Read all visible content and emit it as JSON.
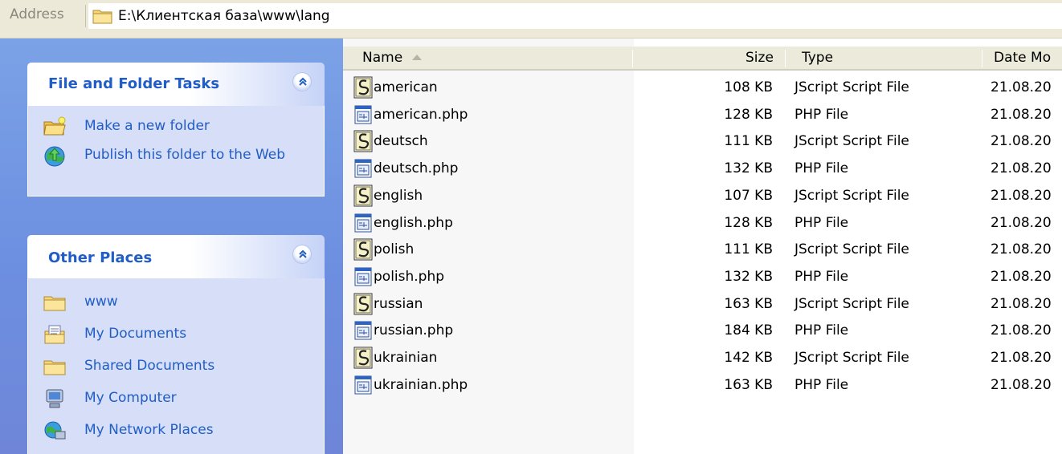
{
  "address": {
    "label": "Address",
    "path": "E:\\Клиентская база\\www\\lang"
  },
  "tasks_panel": {
    "title": "File and Folder Tasks",
    "items": [
      {
        "label": "Make a new folder",
        "icon": "new-folder-icon"
      },
      {
        "label": "Publish this folder to the Web",
        "icon": "globe-publish-icon"
      }
    ]
  },
  "places_panel": {
    "title": "Other Places",
    "items": [
      {
        "label": "www",
        "icon": "folder-icon"
      },
      {
        "label": "My Documents",
        "icon": "my-documents-icon"
      },
      {
        "label": "Shared Documents",
        "icon": "folder-icon"
      },
      {
        "label": "My Computer",
        "icon": "computer-icon"
      },
      {
        "label": "My Network Places",
        "icon": "network-icon"
      }
    ]
  },
  "columns": {
    "name": "Name",
    "size": "Size",
    "type": "Type",
    "date": "Date Mo"
  },
  "files": [
    {
      "name": "american",
      "size": "108 KB",
      "type": "JScript Script File",
      "date": "21.08.20",
      "icon": "jscript-file-icon"
    },
    {
      "name": "american.php",
      "size": "128 KB",
      "type": "PHP File",
      "date": "21.08.20",
      "icon": "php-file-icon"
    },
    {
      "name": "deutsch",
      "size": "111 KB",
      "type": "JScript Script File",
      "date": "21.08.20",
      "icon": "jscript-file-icon"
    },
    {
      "name": "deutsch.php",
      "size": "132 KB",
      "type": "PHP File",
      "date": "21.08.20",
      "icon": "php-file-icon"
    },
    {
      "name": "english",
      "size": "107 KB",
      "type": "JScript Script File",
      "date": "21.08.20",
      "icon": "jscript-file-icon"
    },
    {
      "name": "english.php",
      "size": "128 KB",
      "type": "PHP File",
      "date": "21.08.20",
      "icon": "php-file-icon"
    },
    {
      "name": "polish",
      "size": "111 KB",
      "type": "JScript Script File",
      "date": "21.08.20",
      "icon": "jscript-file-icon"
    },
    {
      "name": "polish.php",
      "size": "132 KB",
      "type": "PHP File",
      "date": "21.08.20",
      "icon": "php-file-icon"
    },
    {
      "name": "russian",
      "size": "163 KB",
      "type": "JScript Script File",
      "date": "21.08.20",
      "icon": "jscript-file-icon"
    },
    {
      "name": "russian.php",
      "size": "184 KB",
      "type": "PHP File",
      "date": "21.08.20",
      "icon": "php-file-icon"
    },
    {
      "name": "ukrainian",
      "size": "142 KB",
      "type": "JScript Script File",
      "date": "21.08.20",
      "icon": "jscript-file-icon"
    },
    {
      "name": "ukrainian.php",
      "size": "163 KB",
      "type": "PHP File",
      "date": "21.08.20",
      "icon": "php-file-icon"
    }
  ],
  "colors": {
    "task_link": "#215dc6",
    "pane_bg": "#7ba2e7",
    "panel_body": "#d6dff7"
  }
}
